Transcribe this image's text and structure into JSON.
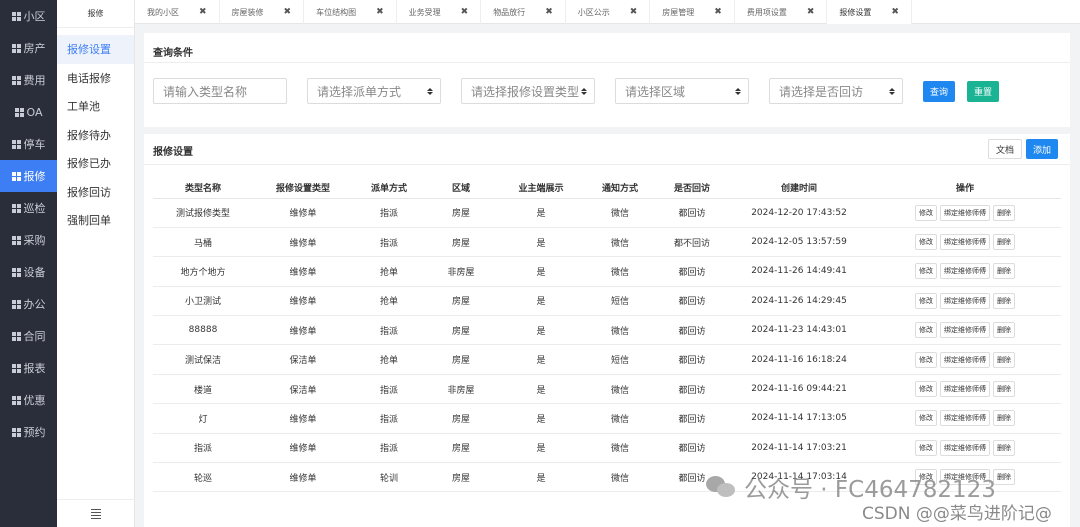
{
  "nav": {
    "items": [
      {
        "label": "小区",
        "active": false
      },
      {
        "label": "房产",
        "active": false
      },
      {
        "label": "费用",
        "active": false
      },
      {
        "label": "OA",
        "active": false
      },
      {
        "label": "停车",
        "active": false
      },
      {
        "label": "报修",
        "active": true
      },
      {
        "label": "巡检",
        "active": false
      },
      {
        "label": "采购",
        "active": false
      },
      {
        "label": "设备",
        "active": false
      },
      {
        "label": "办公",
        "active": false
      },
      {
        "label": "合同",
        "active": false
      },
      {
        "label": "报表",
        "active": false
      },
      {
        "label": "优惠",
        "active": false
      },
      {
        "label": "预约",
        "active": false
      }
    ],
    "accent": "#3d7ef5"
  },
  "subnav": {
    "title": "报修",
    "items": [
      "报修设置",
      "电话报修",
      "工单池",
      "报修待办",
      "报修已办",
      "报修回访",
      "强制回单"
    ],
    "active_index": 0,
    "collapse_icon": "menu-icon"
  },
  "tabs": [
    {
      "label": "我的小区",
      "active": false
    },
    {
      "label": "房屋装修",
      "active": false
    },
    {
      "label": "车位结构图",
      "active": false
    },
    {
      "label": "业务受理",
      "active": false
    },
    {
      "label": "物品放行",
      "active": false
    },
    {
      "label": "小区公示",
      "active": false
    },
    {
      "label": "房屋管理",
      "active": false
    },
    {
      "label": "费用项设置",
      "active": false
    },
    {
      "label": "报修设置",
      "active": true
    }
  ],
  "query": {
    "title": "查询条件",
    "name_placeholder": "请输入类型名称",
    "dispatch_select": "请选择派单方式",
    "type_select": "请选择报修设置类型",
    "area_select": "请选择区域",
    "revisit_select": "请选择是否回访",
    "search_label": "查询",
    "reset_label": "重置"
  },
  "list": {
    "title": "报修设置",
    "doc_label": "文档",
    "add_label": "添加",
    "columns": [
      "类型名称",
      "报修设置类型",
      "派单方式",
      "区域",
      "业主端展示",
      "通知方式",
      "是否回访",
      "创建时间",
      "操作"
    ],
    "rows": [
      [
        "测试报修类型",
        "维修单",
        "指派",
        "房屋",
        "是",
        "微信",
        "都回访",
        "2024-12-20 17:43:52"
      ],
      [
        "马桶",
        "维修单",
        "指派",
        "房屋",
        "是",
        "微信",
        "都不回访",
        "2024-12-05 13:57:59"
      ],
      [
        "地方个地方",
        "维修单",
        "抢单",
        "非房屋",
        "是",
        "微信",
        "都回访",
        "2024-11-26 14:49:41"
      ],
      [
        "小卫测试",
        "维修单",
        "抢单",
        "房屋",
        "是",
        "短信",
        "都回访",
        "2024-11-26 14:29:45"
      ],
      [
        "88888",
        "维修单",
        "指派",
        "房屋",
        "是",
        "微信",
        "都回访",
        "2024-11-23 14:43:01"
      ],
      [
        "测试保洁",
        "保洁单",
        "抢单",
        "房屋",
        "是",
        "短信",
        "都回访",
        "2024-11-16 16:18:24"
      ],
      [
        "楼道",
        "保洁单",
        "指派",
        "非房屋",
        "是",
        "微信",
        "都回访",
        "2024-11-16 09:44:21"
      ],
      [
        "灯",
        "维修单",
        "指派",
        "房屋",
        "是",
        "微信",
        "都回访",
        "2024-11-14 17:13:05"
      ],
      [
        "指派",
        "维修单",
        "指派",
        "房屋",
        "是",
        "微信",
        "都回访",
        "2024-11-14 17:03:21"
      ],
      [
        "轮巡",
        "维修单",
        "轮训",
        "房屋",
        "是",
        "微信",
        "都回访",
        "2024-11-14 17:03:14"
      ]
    ],
    "op_edit": "修改",
    "op_bind": "绑定维修师傅",
    "op_delete": "删除"
  },
  "watermark": {
    "line1": "公众号 · FC464782123",
    "line2": "CSDN @@菜鸟进阶记@"
  }
}
